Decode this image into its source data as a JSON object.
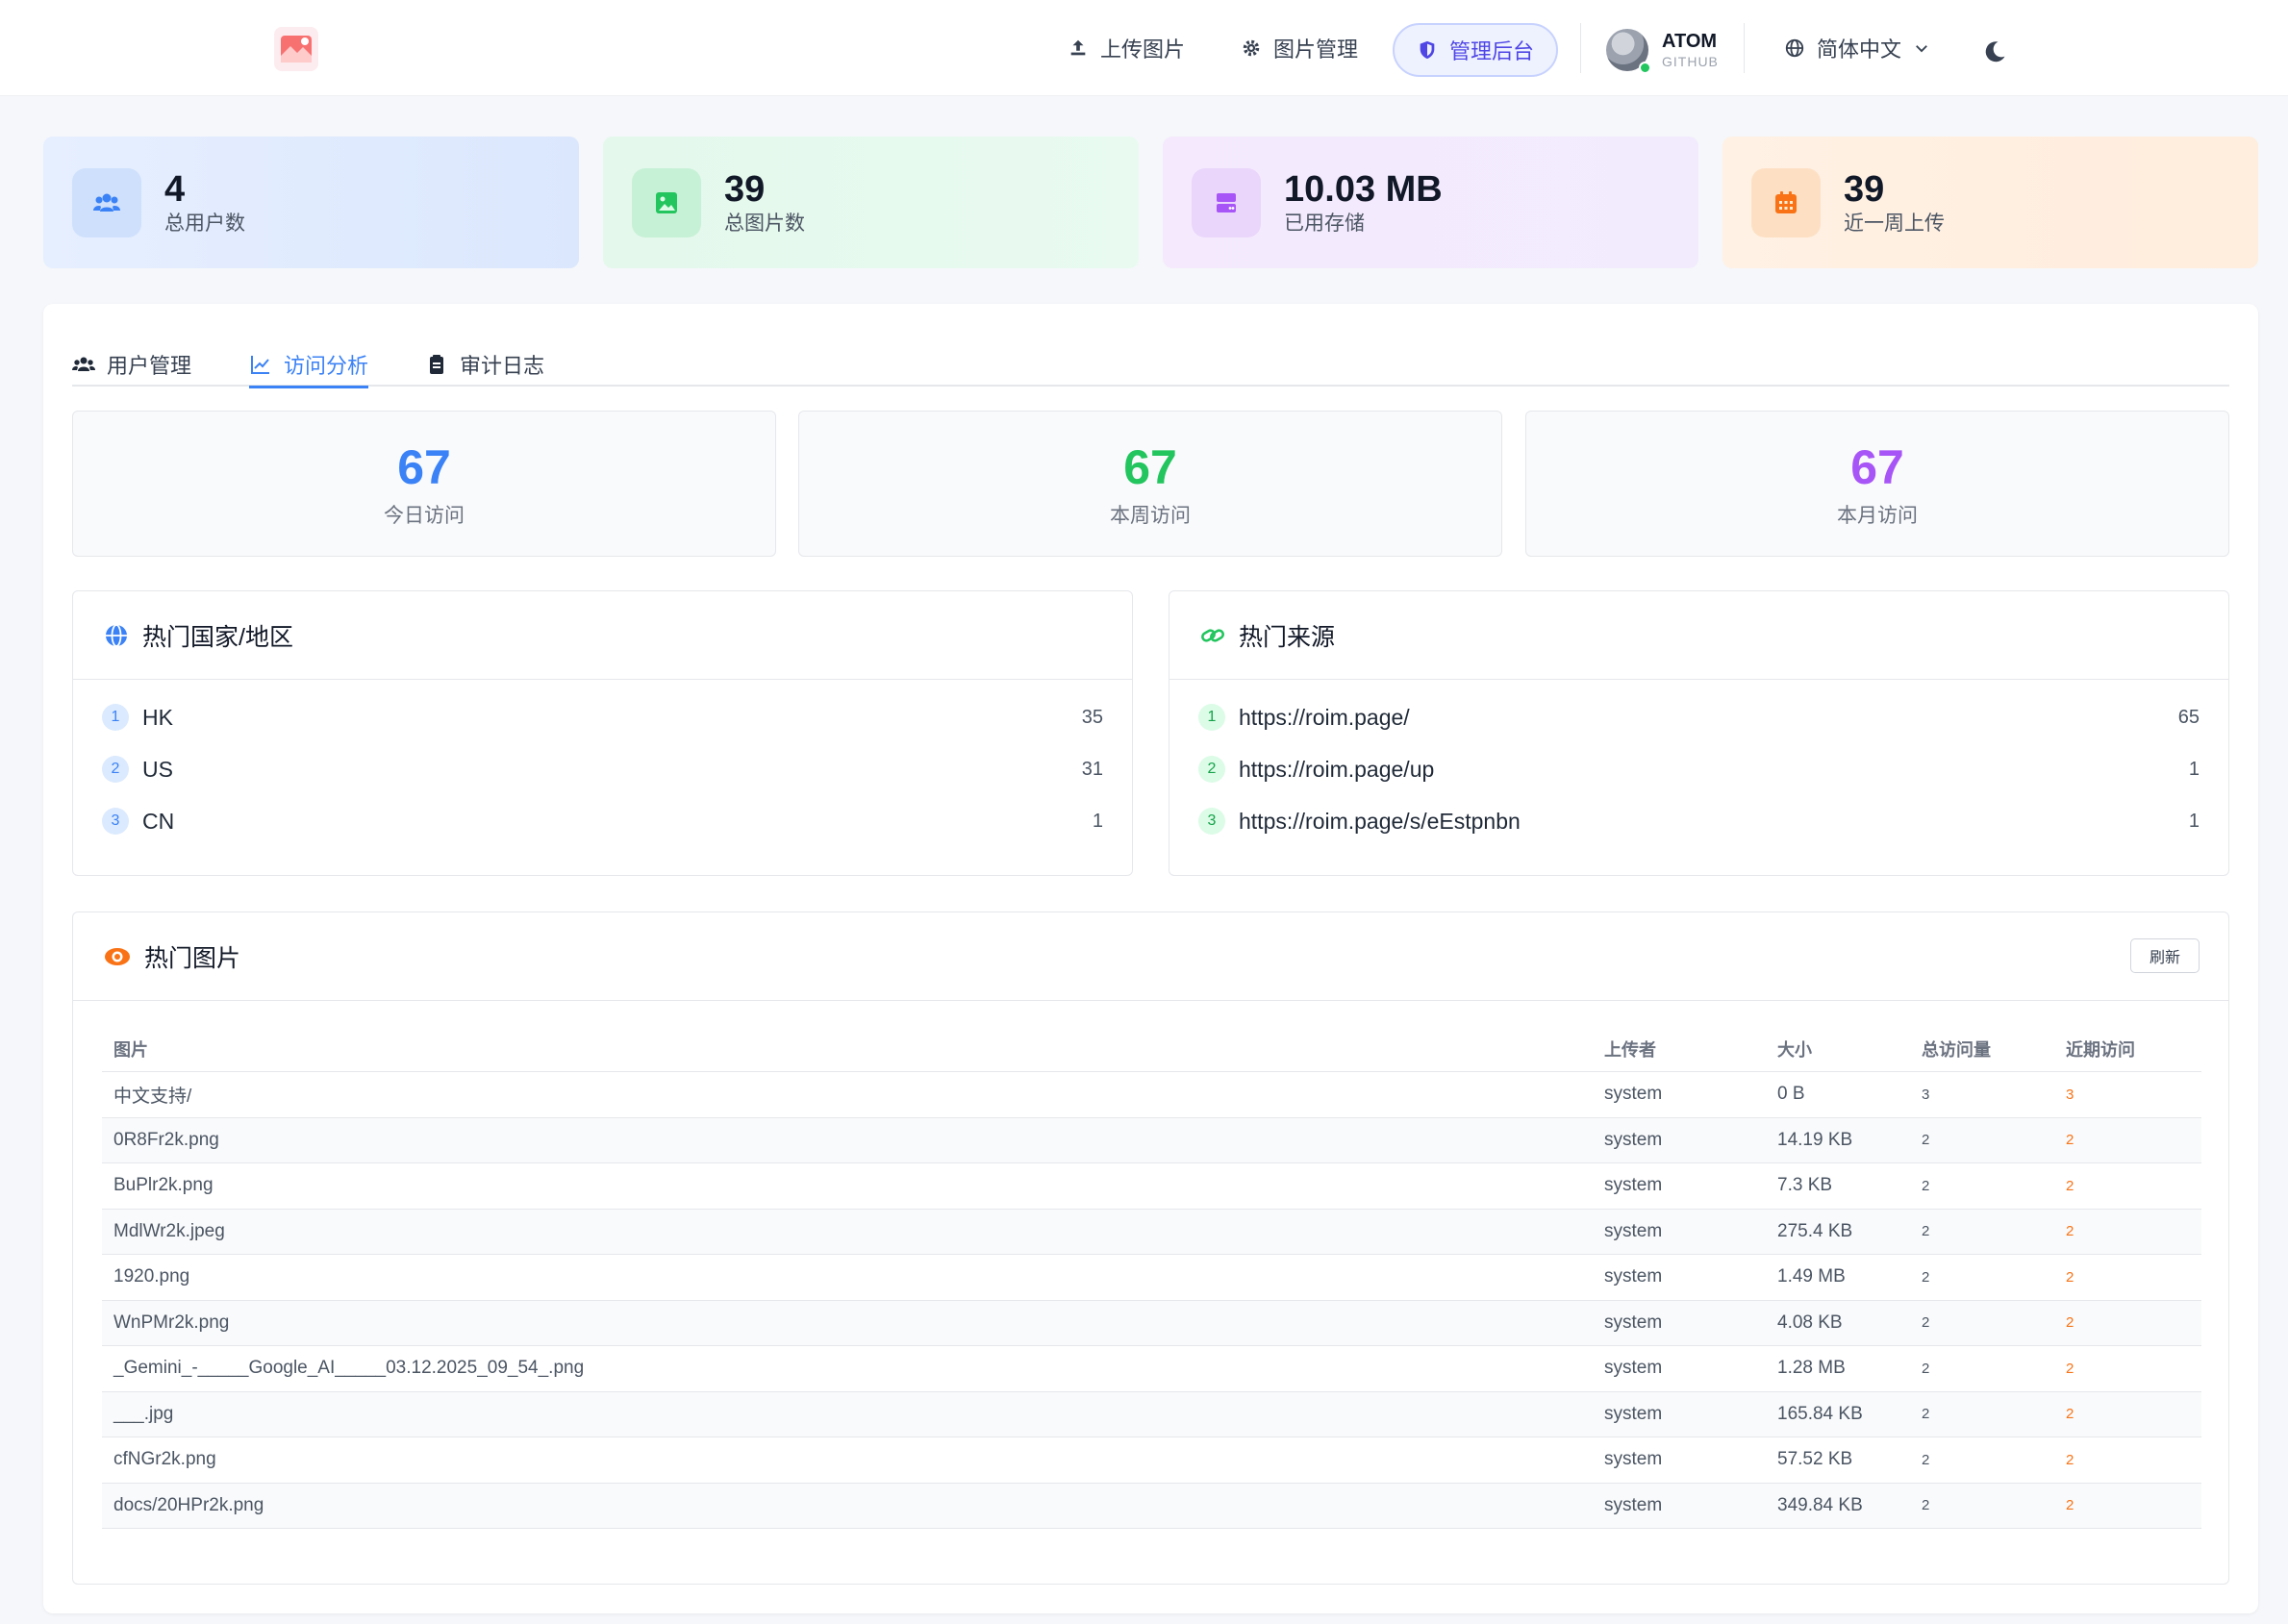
{
  "header": {
    "nav": {
      "upload": "上传图片",
      "manage": "图片管理",
      "admin": "管理后台"
    },
    "user": {
      "name": "ATOM",
      "provider": "GITHUB"
    },
    "language": "简体中文"
  },
  "stats": [
    {
      "value": "4",
      "label": "总用户数",
      "icon": "users-icon",
      "color": "#3b82f6"
    },
    {
      "value": "39",
      "label": "总图片数",
      "icon": "image-icon",
      "color": "#22c55e"
    },
    {
      "value": "10.03 MB",
      "label": "已用存储",
      "icon": "storage-icon",
      "color": "#a855f7"
    },
    {
      "value": "39",
      "label": "近一周上传",
      "icon": "calendar-icon",
      "color": "#f97316"
    }
  ],
  "tabs": [
    {
      "label": "用户管理"
    },
    {
      "label": "访问分析",
      "active": true
    },
    {
      "label": "审计日志"
    }
  ],
  "visits": [
    {
      "value": "67",
      "label": "今日访问"
    },
    {
      "value": "67",
      "label": "本周访问"
    },
    {
      "value": "67",
      "label": "本月访问"
    }
  ],
  "top_countries": {
    "title": "热门国家/地区",
    "items": [
      {
        "rank": "1",
        "name": "HK",
        "count": "35"
      },
      {
        "rank": "2",
        "name": "US",
        "count": "31"
      },
      {
        "rank": "3",
        "name": "CN",
        "count": "1"
      }
    ]
  },
  "top_sources": {
    "title": "热门来源",
    "items": [
      {
        "rank": "1",
        "name": "https://roim.page/",
        "count": "65"
      },
      {
        "rank": "2",
        "name": "https://roim.page/up",
        "count": "1"
      },
      {
        "rank": "3",
        "name": "https://roim.page/s/eEstpnbn",
        "count": "1"
      }
    ]
  },
  "hot_images": {
    "title": "热门图片",
    "refresh": "刷新",
    "columns": [
      "图片",
      "上传者",
      "大小",
      "总访问量",
      "近期访问"
    ],
    "rows": [
      [
        "中文支持/",
        "system",
        "0 B",
        "3",
        "3"
      ],
      [
        "0R8Fr2k.png",
        "system",
        "14.19 KB",
        "2",
        "2"
      ],
      [
        "BuPlr2k.png",
        "system",
        "7.3 KB",
        "2",
        "2"
      ],
      [
        "MdlWr2k.jpeg",
        "system",
        "275.4 KB",
        "2",
        "2"
      ],
      [
        "1920.png",
        "system",
        "1.49 MB",
        "2",
        "2"
      ],
      [
        "WnPMr2k.png",
        "system",
        "4.08 KB",
        "2",
        "2"
      ],
      [
        "_Gemini_-_____Google_AI_____03.12.2025_09_54_.png",
        "system",
        "1.28 MB",
        "2",
        "2"
      ],
      [
        "___.jpg",
        "system",
        "165.84 KB",
        "2",
        "2"
      ],
      [
        "cfNGr2k.png",
        "system",
        "57.52 KB",
        "2",
        "2"
      ],
      [
        "docs/20HPr2k.png",
        "system",
        "349.84 KB",
        "2",
        "2"
      ]
    ]
  }
}
